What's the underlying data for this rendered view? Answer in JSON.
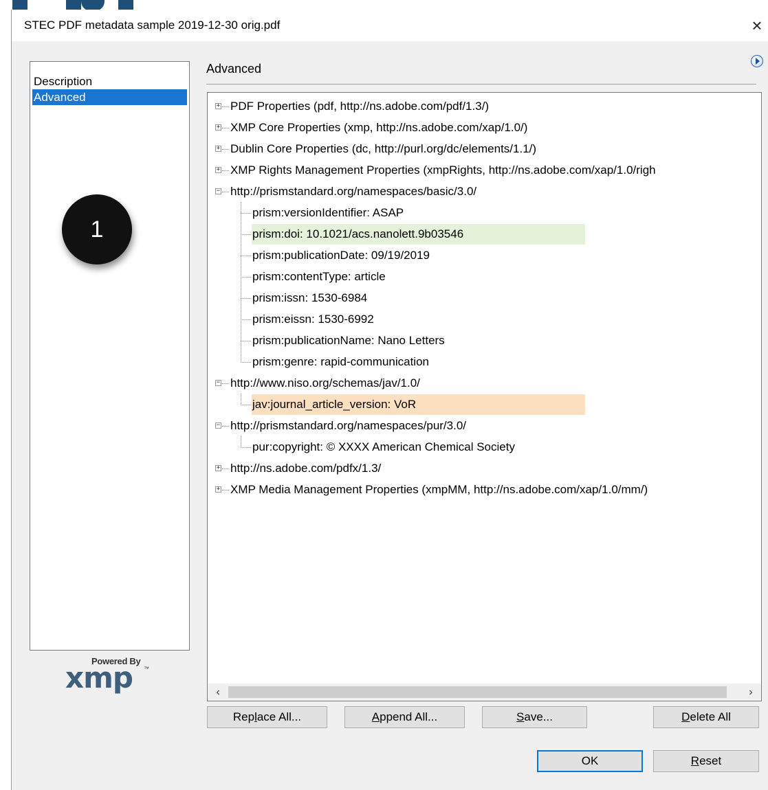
{
  "window": {
    "title": "STEC PDF metadata sample 2019-12-30 orig.pdf",
    "close_glyph": "×"
  },
  "nav": {
    "items": [
      {
        "label": "Description",
        "selected": false
      },
      {
        "label": "Advanced",
        "selected": true
      }
    ]
  },
  "badge": {
    "number": "1"
  },
  "branding": {
    "powered_by": "Powered By",
    "logo_text": "xmp",
    "tm": "™"
  },
  "main": {
    "section_title": "Advanced"
  },
  "tree": {
    "rows": [
      {
        "text": "PDF Properties (pdf, http://ns.adobe.com/pdf/1.3/)",
        "level": 0,
        "expander": "+"
      },
      {
        "text": "XMP Core Properties (xmp, http://ns.adobe.com/xap/1.0/)",
        "level": 0,
        "expander": "+"
      },
      {
        "text": "Dublin Core Properties (dc, http://purl.org/dc/elements/1.1/)",
        "level": 0,
        "expander": "+"
      },
      {
        "text": "XMP Rights Management Properties (xmpRights, http://ns.adobe.com/xap/1.0/righ",
        "level": 0,
        "expander": "+"
      },
      {
        "text": "http://prismstandard.org/namespaces/basic/3.0/",
        "level": 0,
        "expander": "-"
      },
      {
        "text": "prism:versionIdentifier: ASAP",
        "level": 1
      },
      {
        "text": "prism:doi: 10.1021/acs.nanolett.9b03546",
        "level": 1,
        "highlight": "green"
      },
      {
        "text": "prism:publicationDate: 09/19/2019",
        "level": 1
      },
      {
        "text": "prism:contentType: article",
        "level": 1
      },
      {
        "text": "prism:issn: 1530-6984",
        "level": 1
      },
      {
        "text": "prism:eissn: 1530-6992",
        "level": 1
      },
      {
        "text": "prism:publicationName: Nano Letters",
        "level": 1
      },
      {
        "text": "prism:genre: rapid-communication",
        "level": 1
      },
      {
        "text": "http://www.niso.org/schemas/jav/1.0/",
        "level": 0,
        "expander": "-"
      },
      {
        "text": "jav:journal_article_version: VoR",
        "level": 1,
        "highlight": "orange"
      },
      {
        "text": "http://prismstandard.org/namespaces/pur/3.0/",
        "level": 0,
        "expander": "-"
      },
      {
        "text": "pur:copyright: © XXXX American Chemical Society",
        "level": 1
      },
      {
        "text": "http://ns.adobe.com/pdfx/1.3/",
        "level": 0,
        "expander": "+"
      },
      {
        "text": "XMP Media Management Properties (xmpMM, http://ns.adobe.com/xap/1.0/mm/)",
        "level": 0,
        "expander": "+"
      }
    ],
    "scroll_left": "‹",
    "scroll_right": "›"
  },
  "buttons": {
    "replace_all": {
      "pre": "Rep",
      "key": "l",
      "post": "ace All..."
    },
    "append_all": {
      "pre": "",
      "key": "A",
      "post": "ppend All..."
    },
    "save": {
      "pre": "",
      "key": "S",
      "post": "ave..."
    },
    "delete_all": {
      "pre": "",
      "key": "D",
      "post": "elete All"
    },
    "ok": "OK",
    "reset": {
      "pre": "",
      "key": "R",
      "post": "eset"
    }
  },
  "colors": {
    "selection": "#1a75d1",
    "doi_highlight": "#e4f2da",
    "jav_highlight": "#fde0c0",
    "default_button_border": "#0078d7"
  }
}
